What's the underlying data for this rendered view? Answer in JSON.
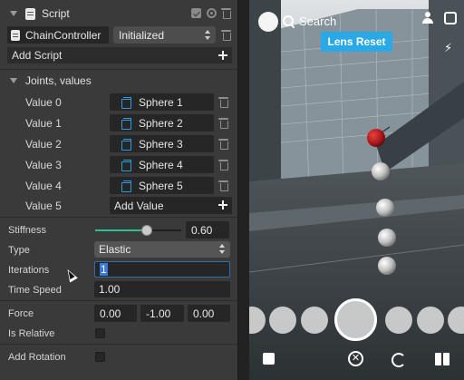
{
  "script": {
    "title": "Script",
    "name": "ChainController",
    "status": "Initialized",
    "add_script_label": "Add Script"
  },
  "joints": {
    "header": "Joints, values",
    "values": [
      {
        "label": "Value 0",
        "object": "Sphere 1"
      },
      {
        "label": "Value 1",
        "object": "Sphere 2"
      },
      {
        "label": "Value 2",
        "object": "Sphere 3"
      },
      {
        "label": "Value 3",
        "object": "Sphere 4"
      },
      {
        "label": "Value 4",
        "object": "Sphere 5"
      }
    ],
    "last_label": "Value 5",
    "add_value_label": "Add Value"
  },
  "properties": {
    "stiffness_label": "Stiffness",
    "stiffness_value": "0.60",
    "stiffness_fraction": 0.6,
    "type_label": "Type",
    "type_value": "Elastic",
    "iterations_label": "Iterations",
    "iterations_value": "1",
    "time_speed_label": "Time Speed",
    "time_speed_value": "1.00",
    "force_label": "Force",
    "force_x": "0.00",
    "force_y": "-1.00",
    "force_z": "0.00",
    "is_relative_label": "Is Relative",
    "add_rotation_label": "Add Rotation"
  },
  "preview": {
    "search_label": "Search",
    "lens_reset_label": "Lens Reset"
  },
  "colors": {
    "accent": "#2bbf93",
    "lens_button": "#2aa9e8",
    "object_icon": "#2e9bdb",
    "red_sphere": "#b3191d"
  }
}
